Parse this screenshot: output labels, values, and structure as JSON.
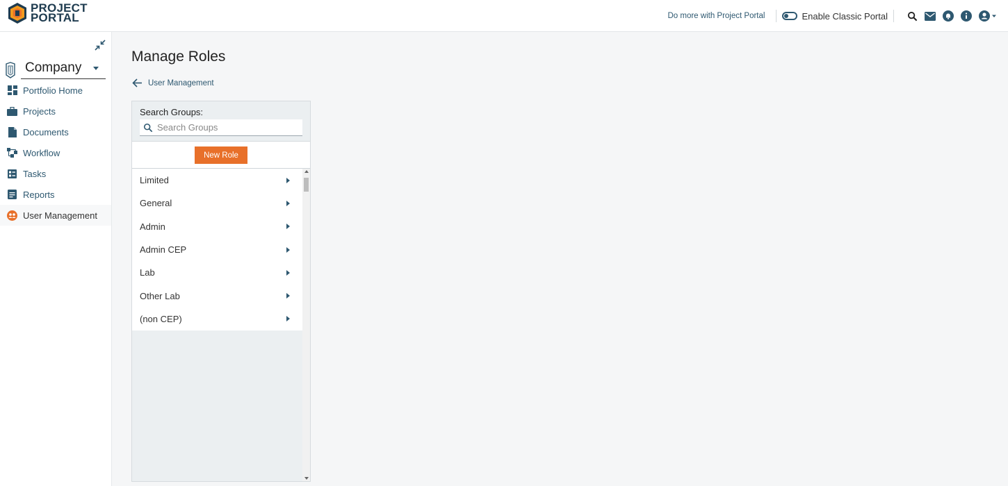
{
  "app": {
    "logo_line1": "PROJECT",
    "logo_line2": "PORTAL"
  },
  "topbar": {
    "do_more": "Do more with Project Portal",
    "classic_toggle_label": "Enable Classic Portal",
    "icons": [
      "search-icon",
      "mail-icon",
      "bell-icon",
      "info-icon",
      "account-icon"
    ]
  },
  "sidebar": {
    "company": "Company",
    "items": [
      {
        "label": "Portfolio Home",
        "icon": "dashboard-icon"
      },
      {
        "label": "Projects",
        "icon": "briefcase-icon"
      },
      {
        "label": "Documents",
        "icon": "document-icon"
      },
      {
        "label": "Workflow",
        "icon": "workflow-icon"
      },
      {
        "label": "Tasks",
        "icon": "tasks-icon"
      },
      {
        "label": "Reports",
        "icon": "report-icon"
      },
      {
        "label": "User Management",
        "icon": "user-management-icon"
      }
    ]
  },
  "main": {
    "title": "Manage Roles",
    "back_label": "User Management",
    "search_label": "Search Groups:",
    "search_placeholder": "Search Groups",
    "new_role_label": "New Role",
    "roles": [
      "Limited",
      "General",
      "Admin",
      "Admin CEP",
      "Lab",
      "Other Lab",
      "(non CEP)"
    ]
  },
  "colors": {
    "accent": "#e8702a",
    "primary": "#2e5870",
    "logo": "#1e3b4f"
  }
}
